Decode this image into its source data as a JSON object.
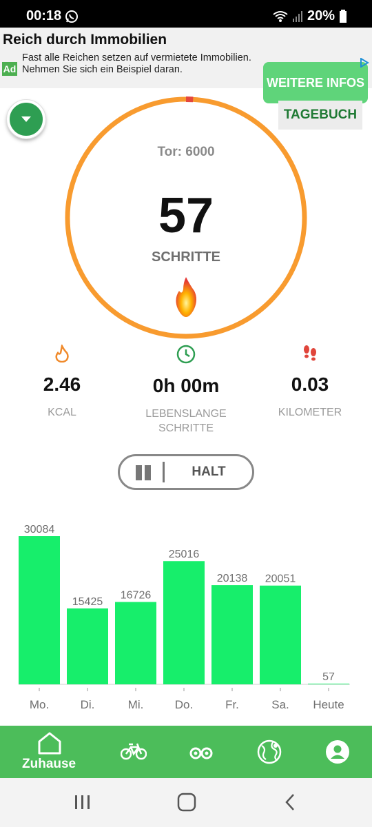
{
  "status_bar": {
    "time": "00:18",
    "battery": "20%"
  },
  "ad": {
    "title": "Reich durch Immobilien",
    "badge": "Ad",
    "text": "Fast alle Reichen setzen auf vermietete Immobilien. Nehmen Sie sich ein Beispiel daran.",
    "cta": "WEITERE INFOS"
  },
  "header": {
    "diary_button": "TAGEBUCH"
  },
  "progress": {
    "goal_text": "Tor: 6000",
    "steps": "57",
    "steps_label": "SCHRITTE",
    "goal": 6000,
    "value": 57
  },
  "stats": [
    {
      "icon": "flame-icon",
      "value": "2.46",
      "label": "KCAL"
    },
    {
      "icon": "clock-icon",
      "value": "0h 00m",
      "label_line1": "LEBENSLANGE",
      "label_line2": "SCHRITTE"
    },
    {
      "icon": "footprints-icon",
      "value": "0.03",
      "label": "KILOMETER"
    }
  ],
  "halt_button": {
    "label": "HALT"
  },
  "chart_data": {
    "type": "bar",
    "categories": [
      "Mo.",
      "Di.",
      "Mi.",
      "Do.",
      "Fr.",
      "Sa.",
      "Heute"
    ],
    "values": [
      30084,
      15425,
      16726,
      25016,
      20138,
      20051,
      57
    ],
    "title": "",
    "xlabel": "",
    "ylabel": "",
    "ylim": [
      0,
      30084
    ],
    "bar_color": "#17ee6b"
  },
  "bottom_nav": {
    "home_label": "Zuhause"
  },
  "colors": {
    "accent": "#4cbd5a",
    "ring": "#f89b2f",
    "bar": "#17ee6b"
  }
}
